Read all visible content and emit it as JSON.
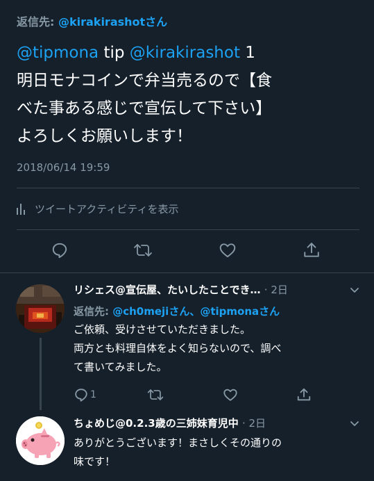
{
  "main_tweet": {
    "reply_to_prefix": "返信先: ",
    "reply_to_handle": "@kirakirashotさん",
    "body": {
      "mention1": "@tipmona",
      "text1": " tip ",
      "mention2": "@kirakirashot",
      "text2": " 1",
      "line2": "明日モナコインで弁当売るので【食",
      "line3": "べた事ある感じで宣伝して下さい】",
      "line4": "よろしくお願いします！"
    },
    "timestamp": "2018/06/14 19:59",
    "activity_label": "ツイートアクティビティを表示"
  },
  "replies": [
    {
      "header": "リシェス@宣伝屋、たいしたことでき…",
      "time": "· 2日",
      "reply_to_prefix": "返信先: ",
      "reply_to_handles": "@ch0mejiさん、@tipmonaさん",
      "lines": [
        "ご依頼、受けさせていただきました。",
        "両方とも料理自体をよく知らないので、調べ",
        "て書いてみました。"
      ],
      "reply_count": "1",
      "avatar_icon": "avatar-photo"
    },
    {
      "header": "ちょめじ@0.2.3歳の三姉妹育児中",
      "time": "· 2日",
      "lines": [
        "ありがとうございます！まさしくその通りの",
        "味です！"
      ],
      "avatar_icon": "piggy-bank-icon"
    }
  ],
  "colors": {
    "background": "#15202b",
    "text": "#ffffff",
    "secondary": "#8899a6",
    "accent": "#1da1f2",
    "divider": "#38444d"
  }
}
